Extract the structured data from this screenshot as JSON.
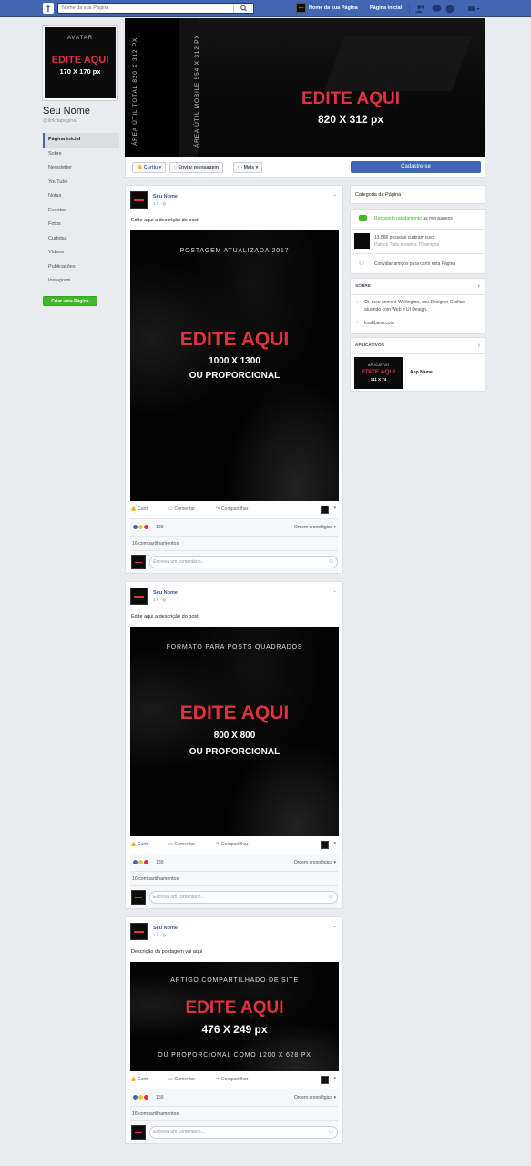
{
  "topbar": {
    "search_placeholder": "Nome da sua Página",
    "page_name": "Nome da sua Página",
    "home_label": "Página inicial"
  },
  "profile": {
    "avatar_label": "AVATAR",
    "avatar_edit": "EDITE AQUI",
    "avatar_size": "170 X 170 px",
    "name": "Seu Nome",
    "username": "@linkdapagina",
    "create_page": "Criar uma Página"
  },
  "sidebar": {
    "items": [
      {
        "label": "Página inicial"
      },
      {
        "label": "Sobre"
      },
      {
        "label": "Newsletter"
      },
      {
        "label": "YouTube"
      },
      {
        "label": "Notas"
      },
      {
        "label": "Eventos"
      },
      {
        "label": "Fotos"
      },
      {
        "label": "Curtidas"
      },
      {
        "label": "Vídeos"
      },
      {
        "label": "Publicações"
      },
      {
        "label": "Instagram"
      }
    ]
  },
  "cover": {
    "vertical_total": "ÁREA ÚTIL TOTAL 820 X 312 PX",
    "vertical_mobile": "ÁREA ÚTIL MOBILE 554 X 312 PX",
    "edit": "EDITE AQUI",
    "size": "820 X 312 px"
  },
  "actions": {
    "like": "Curtiu",
    "message": "Enviar mensagem",
    "more": "Mais",
    "signup": "Cadastre-se"
  },
  "posts": [
    {
      "author": "Seu Nome",
      "time": "1 h",
      "description": "Edite aqui a descrição do post.",
      "image_caption": "POSTAGEM ATUALIZADA 2017",
      "image_edit": "EDITE AQUI",
      "image_size": "1000 X 1300",
      "image_note": "OU PROPORCIONAL",
      "like": "Curtir",
      "comment": "Comentar",
      "share": "Compartilhar",
      "reactions": "138",
      "order": "Ordem cronológica",
      "shares": "16 compartilhamentos",
      "comment_placeholder": "Escreva um comentário..."
    },
    {
      "author": "Seu Nome",
      "time": "1 h",
      "description": "Edite aqui a descrição do post.",
      "image_caption": "FORMATO PARA POSTS QUADRADOS",
      "image_edit": "EDITE AQUI",
      "image_size": "800 X 800",
      "image_note": "OU PROPORCIONAL",
      "like": "Curtir",
      "comment": "Comentar",
      "share": "Compartilhar",
      "reactions": "138",
      "order": "Ordem cronológica",
      "shares": "16 compartilhamentos",
      "comment_placeholder": "Escreva um comentário..."
    },
    {
      "author": "Seu Nome",
      "time": "1 h",
      "description": "Descrição da postagem vai aqui",
      "image_caption": "ARTIGO COMPARTILHADO DE SITE",
      "image_edit": "EDITE AQUI",
      "image_size": "476 X 249 px",
      "image_note": "OU PROPORCIONAL COMO 1200 X 628 PX",
      "like": "Curtir",
      "comment": "Comentar",
      "share": "Compartilhar",
      "reactions": "138",
      "order": "Ordem cronológica",
      "shares": "16 compartilhamentos",
      "comment_placeholder": "Escreva um comentário..."
    }
  ],
  "right": {
    "category": "Categoria da Página",
    "respond_strong": "Responde rapidamente",
    "respond_rest": "às mensagens",
    "likes_line1": "13.886 pessoas curtiram isso",
    "likes_line2": "Patrick Tullo e outros 70 amigos",
    "invite": "Convidar amigos para curtir esta Página",
    "about_title": "SOBRE",
    "about_text": "Oi, meu nome é Wellington, sou Designer Gráfico atuando com Web e UI Design.",
    "about_link": "knabbann.com",
    "apps_title": "APLICATIVOS",
    "app_label": "APLICATIVO",
    "app_edit": "EDITE AQUI",
    "app_size": "111 X 74",
    "app_name": "App Name"
  },
  "colors": {
    "facebook_blue": "#4267b2",
    "accent_red": "#e0323f",
    "green": "#42b72a"
  }
}
